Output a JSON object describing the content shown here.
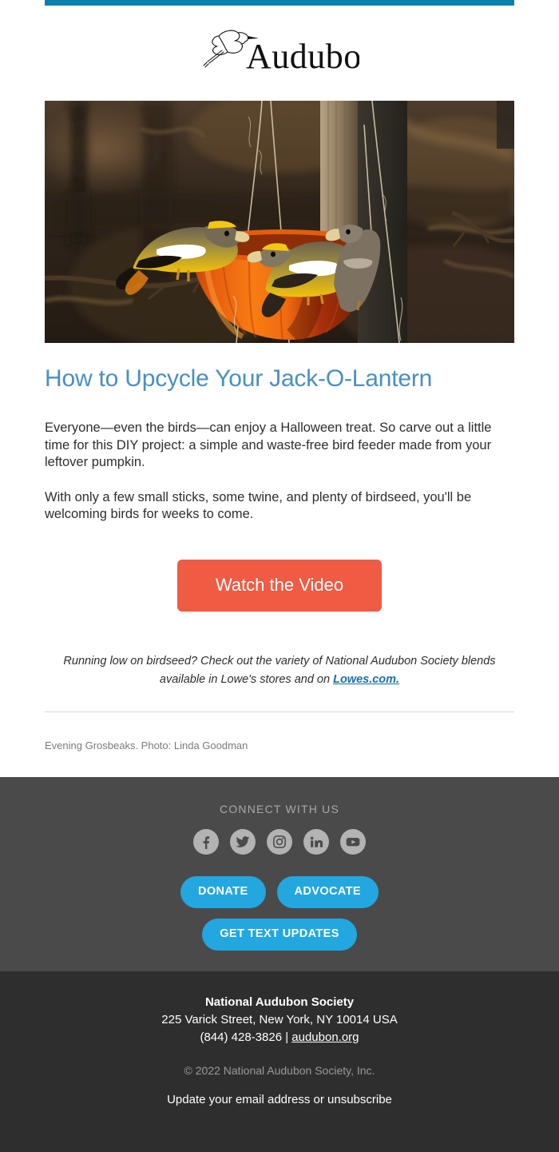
{
  "brand": {
    "name": "Audubon",
    "logo_icon": "flying-egret-logo",
    "accent_bar_color": "#0c80ad"
  },
  "hero": {
    "image_alt": "Three Evening Grosbeaks perched on an orange pumpkin bird feeder hanging from twine in front of a blurred woodland background",
    "subject": "Evening Grosbeaks on pumpkin bird feeder"
  },
  "article": {
    "headline": "How to Upcycle Your Jack-O-Lantern",
    "headline_color": "#4a8fc0",
    "paragraphs": [
      "Everyone—even the birds—can enjoy a Halloween treat. So carve out a little time for this DIY project: a simple and waste-free bird feeder made from your leftover pumpkin.",
      "With only a few small sticks, some twine, and plenty of birdseed, you'll be welcoming birds for weeks to come."
    ]
  },
  "cta": {
    "label": "Watch the Video",
    "color": "#ef5b43"
  },
  "promo": {
    "text_before": "Running low on birdseed? Check out the variety of National Audubon Society blends available in Lowe's stores and on ",
    "link_label": "Lowes.com.",
    "link_color": "#1a6fa8"
  },
  "credit": {
    "text": "Evening Grosbeaks. Photo: Linda Goodman"
  },
  "footer": {
    "connect_label": "CONNECT WITH US",
    "social": [
      {
        "name": "facebook",
        "icon": "facebook-icon"
      },
      {
        "name": "twitter",
        "icon": "twitter-icon"
      },
      {
        "name": "instagram",
        "icon": "instagram-icon"
      },
      {
        "name": "linkedin",
        "icon": "linkedin-icon"
      },
      {
        "name": "youtube",
        "icon": "youtube-icon"
      }
    ],
    "buttons": [
      {
        "label": "DONATE"
      },
      {
        "label": "ADVOCATE"
      },
      {
        "label": "GET TEXT UPDATES"
      }
    ],
    "button_color": "#22a7e0",
    "upper_bg": "#4a4a4a",
    "lower_bg": "#2e2e2e",
    "org_name": "National Audubon Society",
    "address": "225 Varick Street, New York, NY 10014 USA",
    "phone": "(844) 428-3826",
    "separator": " | ",
    "website": "audubon.org",
    "copyright": "© 2022 National Audubon Society, Inc.",
    "unsubscribe": "Update your email address or unsubscribe"
  }
}
